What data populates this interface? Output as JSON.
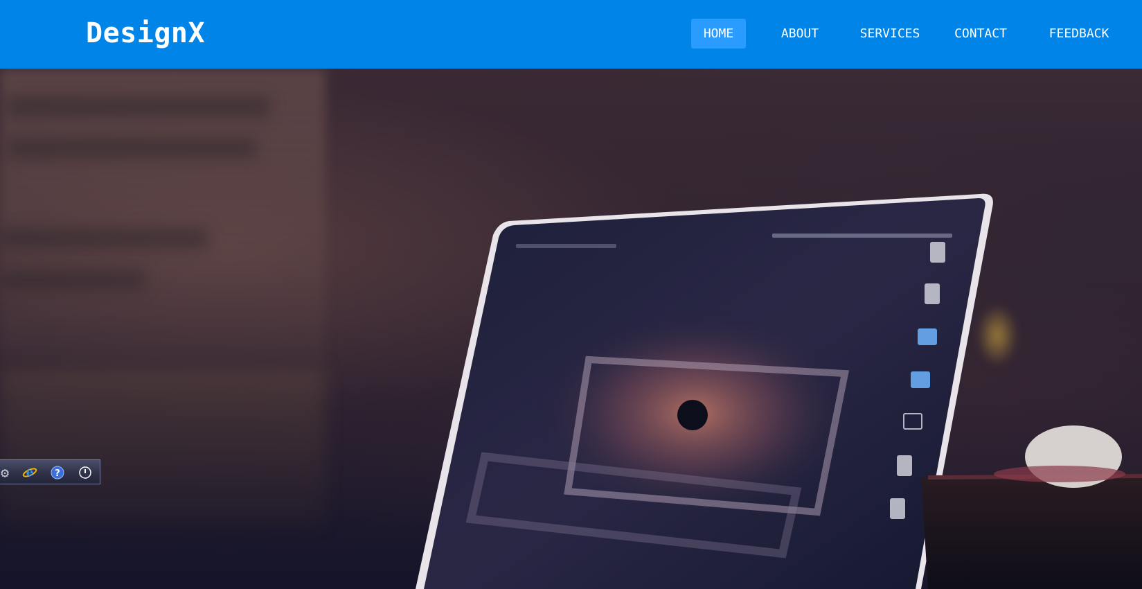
{
  "header": {
    "brand": "DesignX",
    "nav": [
      {
        "label": "HOME",
        "active": true
      },
      {
        "label": "ABOUT",
        "active": false
      },
      {
        "label": "SERVICES",
        "active": false
      },
      {
        "label": "CONTACT",
        "active": false
      },
      {
        "label": "FEEDBACK",
        "active": false
      }
    ]
  },
  "hero": {
    "image": "laptop-on-desk-photo"
  },
  "tray": {
    "icons": [
      "gear-icon",
      "internet-explorer-icon",
      "help-icon",
      "power-icon"
    ]
  },
  "colors": {
    "navbar": "#0084e8",
    "nav_active": "#2a9bff",
    "nav_text": "#ffffff"
  }
}
